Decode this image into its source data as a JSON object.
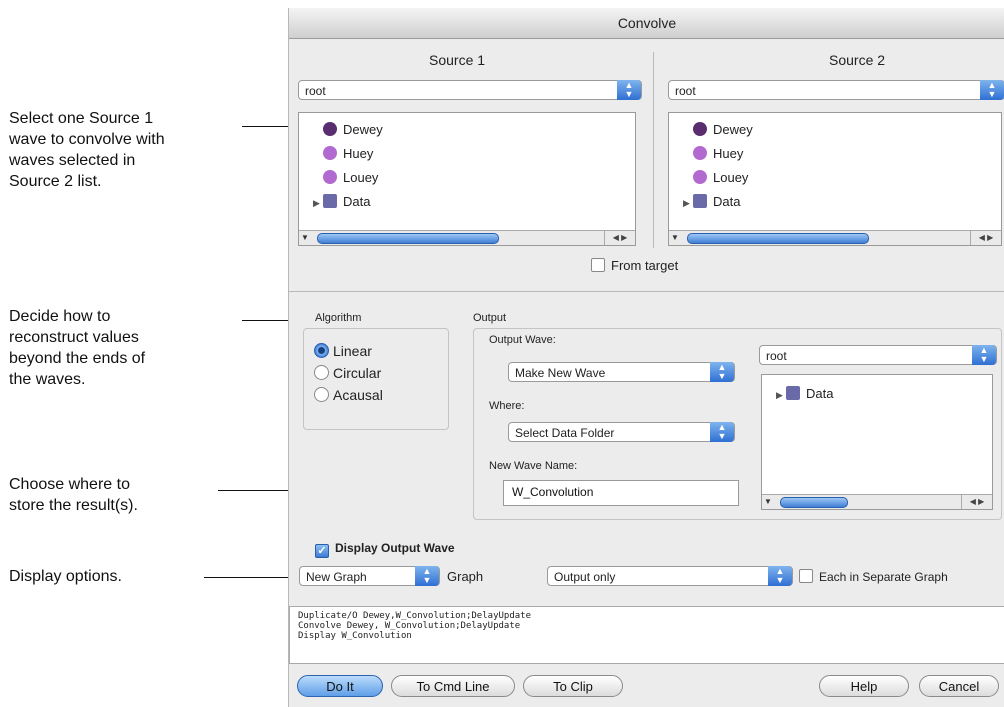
{
  "annotations": {
    "a1_l1": "Select one Source 1",
    "a1_l2": "wave to convolve with",
    "a1_l3": "waves selected in",
    "a1_l4": "Source 2 list.",
    "a2_l1": "Decide how to",
    "a2_l2": "reconstruct values",
    "a2_l3": "beyond the ends of",
    "a2_l4": "the waves.",
    "a3_l1": "Choose where to",
    "a3_l2": "store the result(s).",
    "a4_l1": "Display options."
  },
  "dialog": {
    "title": "Convolve",
    "source1": {
      "label": "Source 1",
      "folder": "root",
      "items": [
        {
          "label": "Dewey"
        },
        {
          "label": "Huey"
        },
        {
          "label": "Louey"
        },
        {
          "label": "Data"
        }
      ]
    },
    "source2": {
      "label": "Source 2",
      "folder": "root",
      "items": [
        {
          "label": "Dewey"
        },
        {
          "label": "Huey"
        },
        {
          "label": "Louey"
        },
        {
          "label": "Data"
        }
      ]
    },
    "from_target": "From target",
    "algorithm": {
      "label": "Algorithm",
      "options": [
        "Linear",
        "Circular",
        "Acausal"
      ],
      "selected": "Linear"
    },
    "output": {
      "label": "Output",
      "wave_label": "Output Wave:",
      "wave_value": "Make New Wave",
      "where_label": "Where:",
      "where_value": "Select Data Folder",
      "name_label": "New Wave Name:",
      "name_value": "W_Convolution",
      "folder": "root",
      "folder_item": "Data"
    },
    "display": {
      "checkbox_label": "Display Output Wave",
      "checked": true,
      "graph_value": "New Graph",
      "graph_label": "Graph",
      "mode_value": "Output only",
      "separate_label": "Each in Separate Graph"
    },
    "command": {
      "line1": "Duplicate/O Dewey,W_Convolution;DelayUpdate",
      "line2": "Convolve Dewey, W_Convolution;DelayUpdate",
      "line3": "Display W_Convolution"
    },
    "buttons": {
      "do_it": "Do It",
      "to_cmd_line": "To Cmd Line",
      "to_clip": "To Clip",
      "help": "Help",
      "cancel": "Cancel"
    }
  },
  "colors": {
    "accent_blue": "#3f7fd6",
    "dialog_bg": "#ececec",
    "wave_icon_dark": "#5a2d6e",
    "wave_icon_light": "#b26ad0"
  }
}
